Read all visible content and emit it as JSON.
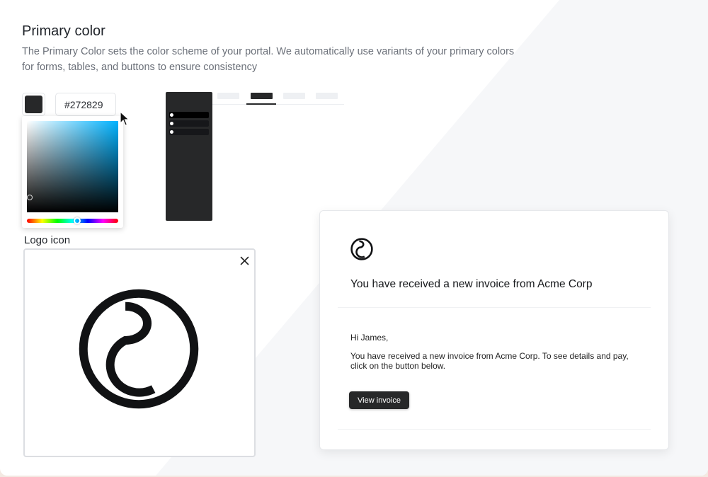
{
  "colors": {
    "primary": "#272829",
    "page_bg": "#ffffff",
    "shape_bg": "#f6f7f9",
    "outer_bg": "#f3e9e2"
  },
  "primary_color": {
    "title": "Primary color",
    "description": "The Primary Color sets the color scheme of your portal. We automatically use variants of your primary colors for forms, tables, and buttons to ensure consistency",
    "hex_value": "#272829",
    "picker": {
      "saturation": 0.03,
      "value": 0.16,
      "hue_fraction": 0.55
    }
  },
  "logo": {
    "label": "Logo icon",
    "remove_icon": "close-icon",
    "image_icon": "brand-logo-icon"
  },
  "email_preview": {
    "logo_icon": "brand-logo-icon",
    "subject": "You have received a new invoice from Acme Corp",
    "greeting": "Hi James,",
    "body": "You have received a new invoice from Acme Corp. To see details and pay, click on the button below.",
    "button_label": "View invoice"
  }
}
